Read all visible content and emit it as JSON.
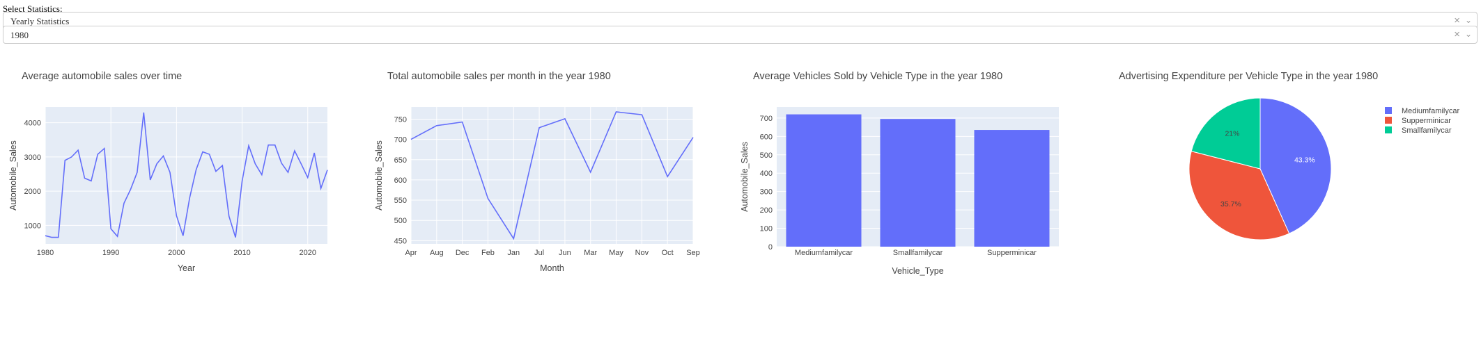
{
  "selector": {
    "label": "Select Statistics:",
    "report_value": "Yearly Statistics",
    "year_value": "1980",
    "clear_glyph": "×",
    "arrow_glyph": "⌄"
  },
  "colors": {
    "line": "#636efa",
    "bar": "#636efa",
    "plot_bg": "#e5ecf6",
    "grid": "#ffffff",
    "pie": [
      "#636efa",
      "#ef553b",
      "#00cc96"
    ]
  },
  "chart_data": [
    {
      "type": "line",
      "title": "Average automobile sales over time",
      "xlabel": "Year",
      "ylabel": "Automobile_Sales",
      "xlim": [
        1980,
        2023
      ],
      "ylim": [
        460,
        4460
      ],
      "xticks": [
        1980,
        1990,
        2000,
        2010,
        2020
      ],
      "yticks": [
        1000,
        2000,
        3000,
        4000
      ],
      "x": [
        1980,
        1981,
        1982,
        1983,
        1984,
        1985,
        1986,
        1987,
        1988,
        1989,
        1990,
        1991,
        1992,
        1993,
        1994,
        1995,
        1996,
        1997,
        1998,
        1999,
        2000,
        2001,
        2002,
        2003,
        2004,
        2005,
        2006,
        2007,
        2008,
        2009,
        2010,
        2011,
        2012,
        2013,
        2014,
        2015,
        2016,
        2017,
        2018,
        2019,
        2020,
        2021,
        2022,
        2023
      ],
      "y": [
        700,
        650,
        650,
        2900,
        3000,
        3200,
        2380,
        2300,
        3080,
        3250,
        900,
        680,
        1650,
        2050,
        2550,
        4300,
        2330,
        2800,
        3030,
        2550,
        1280,
        700,
        1800,
        2630,
        3150,
        3080,
        2580,
        2750,
        1270,
        650,
        2300,
        3330,
        2800,
        2480,
        3350,
        3350,
        2820,
        2550,
        3180,
        2800,
        2400,
        3120,
        2080,
        2620
      ]
    },
    {
      "type": "line",
      "title": "Total automobile sales per month in the year 1980",
      "xlabel": "Month",
      "ylabel": "Automobile_Sales",
      "ylim": [
        442,
        780
      ],
      "yticks": [
        450,
        500,
        550,
        600,
        650,
        700,
        750
      ],
      "categories": [
        "Apr",
        "Aug",
        "Dec",
        "Feb",
        "Jan",
        "Jul",
        "Jun",
        "Mar",
        "May",
        "Nov",
        "Oct",
        "Sep"
      ],
      "values": [
        700,
        734,
        743,
        554,
        455,
        729,
        751,
        619,
        768,
        761,
        608,
        705
      ]
    },
    {
      "type": "bar",
      "title": "Average Vehicles Sold by Vehicle Type in the year 1980",
      "xlabel": "Vehicle_Type",
      "ylabel": "Automobile_Sales",
      "ylim": [
        0,
        760
      ],
      "yticks": [
        0,
        100,
        200,
        300,
        400,
        500,
        600,
        700
      ],
      "categories": [
        "Mediumfamilycar",
        "Smallfamilycar",
        "Supperminicar"
      ],
      "values": [
        720,
        695,
        635
      ]
    },
    {
      "type": "pie",
      "title": "Advertising Expenditure per Vehicle Type in the year 1980",
      "labels": [
        "Mediumfamilycar",
        "Supperminicar",
        "Smallfamilycar"
      ],
      "values": [
        43.3,
        35.7,
        21
      ],
      "value_labels": [
        "43.3%",
        "35.7%",
        "21%"
      ],
      "legend_position": "top-right"
    }
  ]
}
